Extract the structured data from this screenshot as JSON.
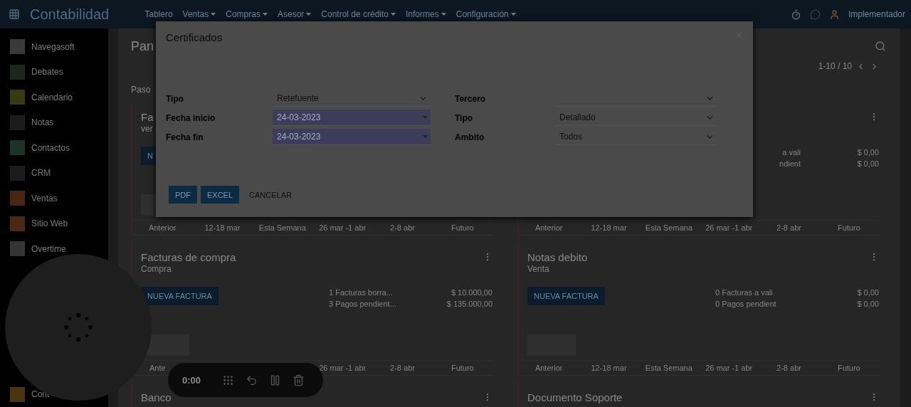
{
  "topbar": {
    "app_title": "Contabilidad",
    "menus": [
      {
        "label": "Tablero",
        "dropdown": false
      },
      {
        "label": "Ventas",
        "dropdown": true
      },
      {
        "label": "Compras",
        "dropdown": true
      },
      {
        "label": "Asesor",
        "dropdown": true
      },
      {
        "label": "Control de crédito",
        "dropdown": true
      },
      {
        "label": "Informes",
        "dropdown": true
      },
      {
        "label": "Configuración",
        "dropdown": true
      }
    ],
    "user": "Implementador"
  },
  "sidebar": {
    "items": [
      {
        "label": "Navegasoft",
        "color": "#3a3a3a"
      },
      {
        "label": "Debates",
        "color": "#1f2620"
      },
      {
        "label": "Calendario",
        "color": "#3a3a12"
      },
      {
        "label": "Notas",
        "color": "#1c1c1c"
      },
      {
        "label": "Contactos",
        "color": "#1d3329"
      },
      {
        "label": "CRM",
        "color": "#1c1c1c"
      },
      {
        "label": "Ventas",
        "color": "#4a2514"
      },
      {
        "label": "Sitio Web",
        "color": "#4a2a16"
      },
      {
        "label": "Overtime",
        "color": "#343434"
      }
    ],
    "bottom_items": [
      {
        "label": "Cont",
        "color": "#4a3510"
      }
    ]
  },
  "main": {
    "title": "Pan",
    "pager": "1-10 / 10",
    "filter": "Paso",
    "columns": [
      [
        {
          "title": "Fa",
          "subtitle": "ver",
          "button": "N",
          "periods": [
            {
              "kind": "label",
              "label": "Anterior"
            },
            {
              "kind": "label",
              "label": "12-18 mar"
            },
            {
              "kind": "label",
              "label": "Esta Semana"
            },
            {
              "kind": "label",
              "label": "26 mar -1 abr"
            },
            {
              "kind": "label",
              "label": "2-8 abr"
            },
            {
              "kind": "label",
              "label": "Futuro"
            }
          ]
        },
        {
          "title": "Facturas de compra",
          "subtitle": "Compra",
          "button": "NUEVA FACTURA",
          "stats": [
            {
              "kind": "full",
              "label": "1 Facturas borra...",
              "amount": "$ 10.000,00"
            },
            {
              "kind": "full",
              "label": "3 Pagos pendient...",
              "amount": "$ 135.000,00"
            }
          ],
          "periods": [
            {
              "kind": "clipped",
              "label": "Ante"
            },
            {
              "kind": "covered"
            },
            {
              "kind": "covered"
            },
            {
              "kind": "label",
              "label": "26 mar -1 abr"
            },
            {
              "kind": "label",
              "label": "2-8 abr"
            },
            {
              "kind": "label",
              "label": "Futuro"
            }
          ]
        },
        {
          "title": "Banco"
        }
      ],
      [
        {
          "stats": [
            {
              "kind": "clipped",
              "label": "a vali",
              "amount": "$ 0,00"
            },
            {
              "kind": "clipped",
              "label": "ndient",
              "amount": "$ 0,00"
            }
          ],
          "periods": [
            {
              "kind": "label",
              "label": "Anterior"
            },
            {
              "kind": "label",
              "label": "12-18 mar"
            },
            {
              "kind": "label",
              "label": "Esta Semana"
            },
            {
              "kind": "label",
              "label": "26 mar -1 abr"
            },
            {
              "kind": "label",
              "label": "2-8 abr"
            },
            {
              "kind": "label",
              "label": "Futuro"
            }
          ]
        },
        {
          "title": "Notas debito",
          "subtitle": "Venta",
          "button": "NUEVA FACTURA",
          "stats": [
            {
              "kind": "full",
              "label": "0 Facturas a vali",
              "amount": "$ 0,00"
            },
            {
              "kind": "full",
              "label": "0 Pagos pendient",
              "amount": "$ 0,00"
            }
          ],
          "periods": [
            {
              "kind": "label",
              "label": "Anterior"
            },
            {
              "kind": "label",
              "label": "12-18 mar"
            },
            {
              "kind": "label",
              "label": "Esta Semana"
            },
            {
              "kind": "label",
              "label": "26 mar -1 abr"
            },
            {
              "kind": "label",
              "label": "2-8 abr"
            },
            {
              "kind": "label",
              "label": "Futuro"
            }
          ]
        },
        {
          "title": "Documento Soporte"
        }
      ]
    ]
  },
  "dialog": {
    "title": "Certificados",
    "left_fields": [
      {
        "label": "Tipo",
        "value": "Retefuente",
        "required": false
      },
      {
        "label": "Fecha inicio",
        "value": "24-03-2023",
        "required": true
      },
      {
        "label": "Fecha fin",
        "value": "24-03-2023",
        "required": true
      }
    ],
    "right_fields": [
      {
        "label": "Tercero",
        "required": false
      },
      {
        "label": "Tipo",
        "value": "Detallado",
        "required": false
      },
      {
        "label": "Ambito",
        "value": "Todos",
        "required": false
      }
    ],
    "buttons": [
      {
        "label": "PDF",
        "kind": "primary"
      },
      {
        "label": "EXCEL",
        "kind": "primary"
      },
      {
        "label": "CANCELAR",
        "kind": "link"
      }
    ]
  },
  "recorder": {
    "time": "0:00"
  }
}
